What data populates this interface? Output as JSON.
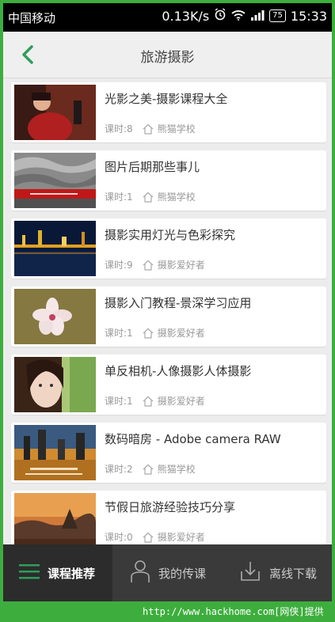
{
  "status_bar": {
    "carrier": "中国移动",
    "speed": "0.13K/s",
    "battery": "75",
    "time": "15:33"
  },
  "header": {
    "title": "旅游摄影"
  },
  "courses": [
    {
      "title": "光影之美-摄影课程大全",
      "lessons": "课时:8",
      "author": "熊猫学校"
    },
    {
      "title": "图片后期那些事儿",
      "lessons": "课时:1",
      "author": "熊猫学校"
    },
    {
      "title": "摄影实用灯光与色彩探究",
      "lessons": "课时:9",
      "author": "摄影爱好者"
    },
    {
      "title": "摄影入门教程-景深学习应用",
      "lessons": "课时:1",
      "author": "摄影爱好者"
    },
    {
      "title": "单反相机-人像摄影人体摄影",
      "lessons": "课时:1",
      "author": "摄影爱好者"
    },
    {
      "title": "数码暗房 - Adobe camera RAW",
      "lessons": "课时:2",
      "author": "熊猫学校"
    },
    {
      "title": "节假日旅游经验技巧分享",
      "lessons": "课时:0",
      "author": "摄影爱好者"
    }
  ],
  "bottom_nav": [
    {
      "label": "课程推荐",
      "icon": "menu-icon"
    },
    {
      "label": "我的传课",
      "icon": "person-icon"
    },
    {
      "label": "离线下载",
      "icon": "download-icon"
    }
  ],
  "watermark": "http://www.hackhome.com[网侠]提供",
  "colors": {
    "accent": "#2e9e5b",
    "watermark_bg": "#3dae3d"
  }
}
